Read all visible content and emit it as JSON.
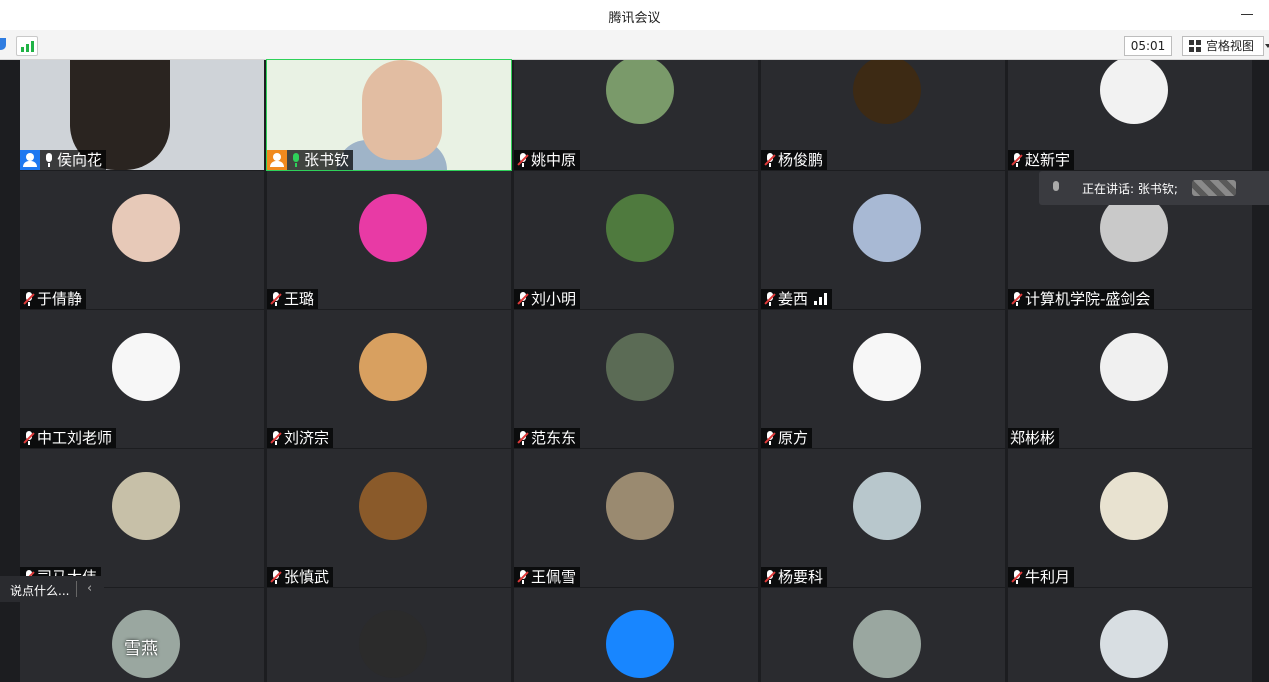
{
  "window": {
    "title": "腾讯会议"
  },
  "toolbar": {
    "timer": "05:01",
    "view_label": "宫格视图"
  },
  "speaking": {
    "label": "正在讲话: 张书钦;"
  },
  "chat": {
    "placeholder": "说点什么..."
  },
  "participants": [
    {
      "name": "侯向花",
      "mic": "live",
      "role": "blue",
      "type": "video"
    },
    {
      "name": "张书钦",
      "mic": "on",
      "role": "orange",
      "type": "video"
    },
    {
      "name": "姚中原",
      "mic": "muted",
      "role": "",
      "type": "avatar"
    },
    {
      "name": "杨俊鹏",
      "mic": "muted",
      "role": "",
      "type": "avatar"
    },
    {
      "name": "赵新宇",
      "mic": "muted",
      "role": "",
      "type": "avatar"
    },
    {
      "name": "于倩静",
      "mic": "muted",
      "role": "",
      "type": "avatar"
    },
    {
      "name": "王璐",
      "mic": "muted",
      "role": "",
      "type": "avatar"
    },
    {
      "name": "刘小明",
      "mic": "muted",
      "role": "",
      "type": "avatar"
    },
    {
      "name": "姜西",
      "mic": "muted",
      "role": "",
      "type": "avatar",
      "signal": true
    },
    {
      "name": "计算机学院-盛剑会",
      "mic": "muted",
      "role": "",
      "type": "avatar"
    },
    {
      "name": "中工刘老师",
      "mic": "muted",
      "role": "",
      "type": "avatar"
    },
    {
      "name": "刘济宗",
      "mic": "muted",
      "role": "",
      "type": "avatar"
    },
    {
      "name": "范东东",
      "mic": "muted",
      "role": "",
      "type": "avatar"
    },
    {
      "name": "原方",
      "mic": "muted",
      "role": "",
      "type": "avatar"
    },
    {
      "name": "郑彬彬",
      "mic": "none",
      "role": "",
      "type": "avatar"
    },
    {
      "name": "司马大伟",
      "mic": "muted",
      "role": "",
      "type": "avatar"
    },
    {
      "name": "张慎武",
      "mic": "muted",
      "role": "",
      "type": "avatar"
    },
    {
      "name": "王佩雪",
      "mic": "muted",
      "role": "",
      "type": "avatar"
    },
    {
      "name": "杨要科",
      "mic": "muted",
      "role": "",
      "type": "avatar"
    },
    {
      "name": "牛利月",
      "mic": "muted",
      "role": "",
      "type": "avatar"
    },
    {
      "name": "",
      "mic": "none",
      "role": "",
      "type": "avatar",
      "overlay_text": "雪燕"
    },
    {
      "name": "",
      "mic": "none",
      "role": "",
      "type": "avatar"
    },
    {
      "name": "",
      "mic": "none",
      "role": "",
      "type": "avatar"
    },
    {
      "name": "",
      "mic": "none",
      "role": "",
      "type": "avatar"
    },
    {
      "name": "",
      "mic": "none",
      "role": "",
      "type": "avatar"
    }
  ],
  "colors": {
    "role_blue": "#1e78f0",
    "role_orange": "#f08a1e",
    "avatars": [
      "#7a9a6a",
      "#3d2a14",
      "#f2f2f2",
      "#e7c9b8",
      "#e83aa5",
      "#4f7a3e",
      "#a8b9d4",
      "#c9c9c9",
      "#f7f7f7",
      "#d8a060",
      "#5b6b55",
      "#f7f7f7",
      "#f0f0f0",
      "#c7c0a8",
      "#8a5a2a",
      "#9a8a70",
      "#b8c7cc",
      "#e8e2d0",
      "#9aa7a0",
      "#2b2b2b",
      "#1886ff",
      "#9aa7a0",
      "#d8dee2"
    ]
  }
}
